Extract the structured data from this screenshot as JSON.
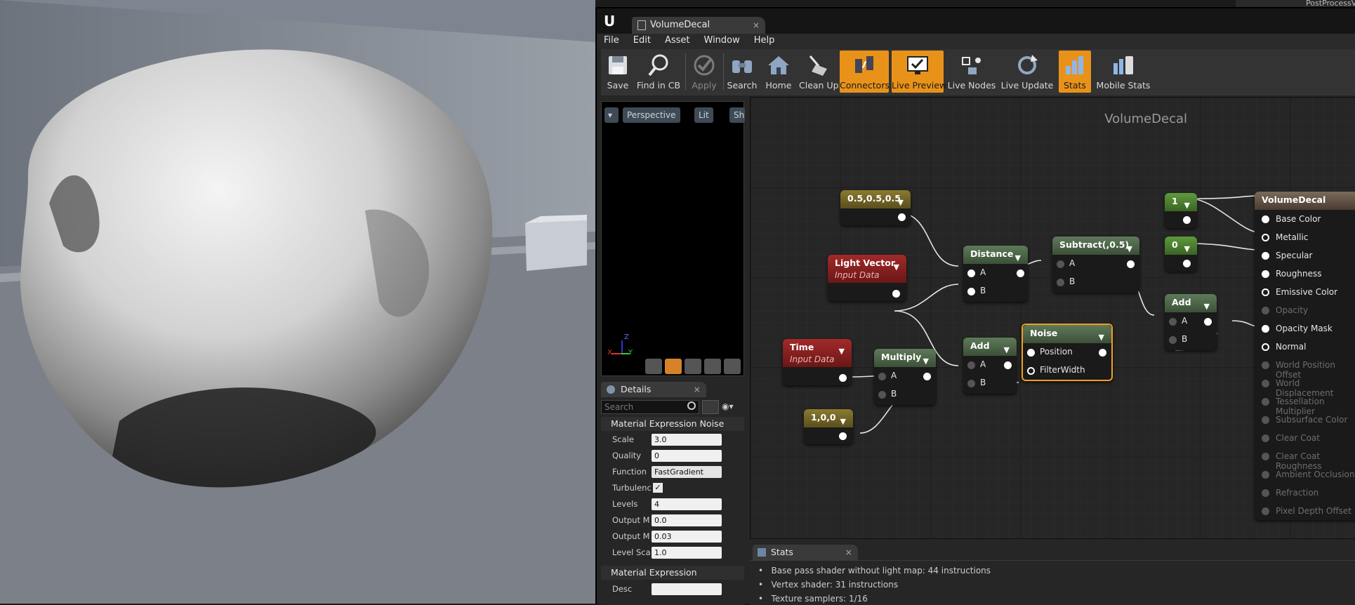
{
  "document_tab": {
    "title": "VolumeDecal",
    "close": "×"
  },
  "menu": [
    "File",
    "Edit",
    "Asset",
    "Window",
    "Help"
  ],
  "toolbar": [
    {
      "id": "save",
      "label": "Save",
      "icon": "save-icon",
      "state": "normal"
    },
    {
      "id": "find",
      "label": "Find in CB",
      "icon": "magnifier-icon",
      "state": "normal"
    },
    {
      "id": "apply",
      "label": "Apply",
      "icon": "checkmark-icon",
      "state": "disabled"
    },
    {
      "id": "search",
      "label": "Search",
      "icon": "binoculars-icon",
      "state": "normal"
    },
    {
      "id": "home",
      "label": "Home",
      "icon": "home-icon",
      "state": "normal"
    },
    {
      "id": "cleanup",
      "label": "Clean Up",
      "icon": "broom-icon",
      "state": "normal"
    },
    {
      "id": "connectors",
      "label": "Connectors",
      "icon": "connectors-icon",
      "state": "active"
    },
    {
      "id": "livepreview",
      "label": "Live Preview",
      "icon": "monitor-icon",
      "state": "active"
    },
    {
      "id": "livenodes",
      "label": "Live Nodes",
      "icon": "nodes-icon",
      "state": "normal"
    },
    {
      "id": "liveupdate",
      "label": "Live Update",
      "icon": "refresh-icon",
      "state": "normal"
    },
    {
      "id": "stats",
      "label": "Stats",
      "icon": "bar-chart-icon",
      "state": "active"
    },
    {
      "id": "mobilestats",
      "label": "Mobile Stats",
      "icon": "mobile-chart-icon",
      "state": "normal"
    }
  ],
  "preview": {
    "buttons": [
      "Perspective",
      "Lit",
      "Sh"
    ],
    "axis_x": "X",
    "axis_y": "Y",
    "axis_z": "Z"
  },
  "details": {
    "tab": "Details",
    "close": "×",
    "search_placeholder": "Search",
    "category1": "Material Expression Noise",
    "properties": [
      {
        "label": "Scale",
        "value": "3.0"
      },
      {
        "label": "Quality",
        "value": "0"
      },
      {
        "label": "Function",
        "value": "FastGradient"
      },
      {
        "label": "Turbulenc",
        "value": "checked"
      },
      {
        "label": "Levels",
        "value": "4"
      },
      {
        "label": "Output M",
        "value": "0.0"
      },
      {
        "label": "Output M",
        "value": "0.03"
      },
      {
        "label": "Level Sca",
        "value": "1.0"
      }
    ],
    "category2": "Material Expression",
    "desc_label": "Desc"
  },
  "graph": {
    "title": "VolumeDecal",
    "nodes": {
      "const3": {
        "title": "0.5,0.5,0.5"
      },
      "light": {
        "title": "Light Vector",
        "subtitle": "Input Data"
      },
      "distance": {
        "title": "Distance",
        "a": "A",
        "b": "B"
      },
      "subtract": {
        "title": "Subtract(,0.5)",
        "a": "A",
        "b": "B"
      },
      "time": {
        "title": "Time",
        "subtitle": "Input Data"
      },
      "multiply": {
        "title": "Multiply",
        "a": "A",
        "b": "B"
      },
      "vec": {
        "title": "1,0,0"
      },
      "add1": {
        "title": "Add",
        "a": "A",
        "b": "B"
      },
      "noise": {
        "title": "Noise",
        "position": "Position",
        "filterwidth": "FilterWidth"
      },
      "one": {
        "title": "1"
      },
      "zero": {
        "title": "0"
      },
      "add2": {
        "title": "Add",
        "a": "A",
        "b": "B"
      }
    },
    "result": {
      "title": "VolumeDecal",
      "pins": [
        {
          "label": "Base Color",
          "enabled": true
        },
        {
          "label": "Metallic",
          "enabled": true
        },
        {
          "label": "Specular",
          "enabled": true
        },
        {
          "label": "Roughness",
          "enabled": true
        },
        {
          "label": "Emissive Color",
          "enabled": true
        },
        {
          "label": "Opacity",
          "enabled": false
        },
        {
          "label": "Opacity Mask",
          "enabled": true
        },
        {
          "label": "Normal",
          "enabled": true
        },
        {
          "label": "World Position Offset",
          "enabled": false
        },
        {
          "label": "World Displacement",
          "enabled": false
        },
        {
          "label": "Tessellation Multiplier",
          "enabled": false
        },
        {
          "label": "Subsurface Color",
          "enabled": false
        },
        {
          "label": "Clear Coat",
          "enabled": false
        },
        {
          "label": "Clear Coat Roughness",
          "enabled": false
        },
        {
          "label": "Ambient Occlusion",
          "enabled": false
        },
        {
          "label": "Refraction",
          "enabled": false
        },
        {
          "label": "Pixel Depth Offset",
          "enabled": false
        }
      ]
    }
  },
  "stats": {
    "tab": "Stats",
    "close": "×",
    "lines": [
      "Base pass shader without light map: 44 instructions",
      "Vertex shader: 31 instructions",
      "Texture samplers: 1/16"
    ]
  },
  "corner_label": "PostProcessV"
}
